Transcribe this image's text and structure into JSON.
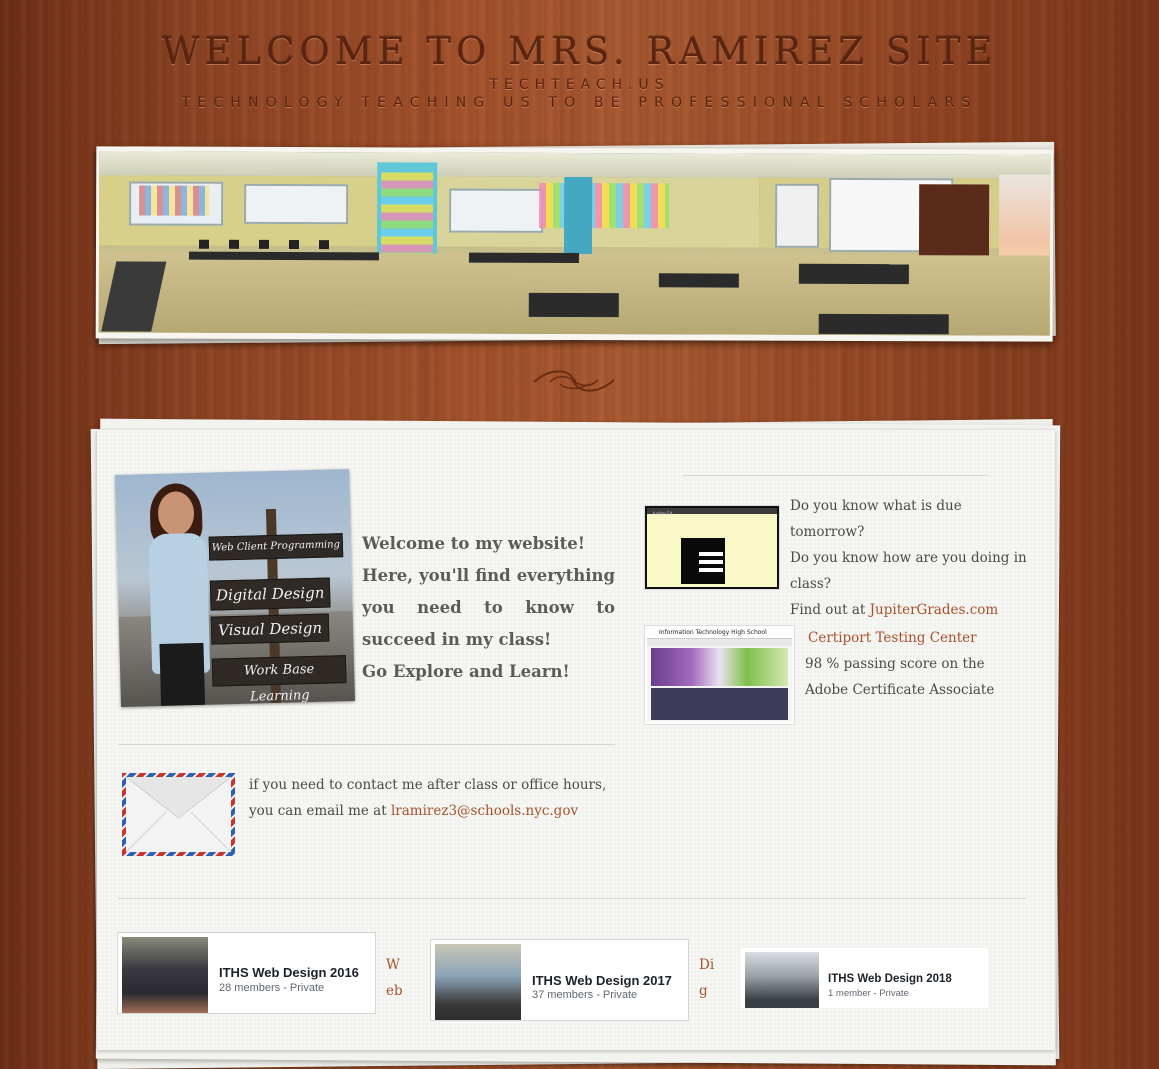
{
  "header": {
    "title": "WELCOME TO MRS. RAMIREZ SITE",
    "subtitle_domain": "TECHTEACH.US",
    "tagline": "TECHNOLOGY TEACHING US TO BE PROFESSIONAL SCHOLARS"
  },
  "banner": {
    "image": "classroom panorama photo"
  },
  "profile": {
    "image": "teacher photo with signpost",
    "signs": [
      "Web Client Programming",
      "Digital Design",
      "Visual Design",
      "Work Base Learning"
    ]
  },
  "welcome": {
    "line1": "Welcome to my website!",
    "line2": "Here, you'll find everything you need to know to succeed in my class!",
    "line3": "Go Explore and Learn!"
  },
  "jupiter": {
    "thumb_label": "Jupiter Ed",
    "line1": "Do you know what is due tomorrow?",
    "line2": "Do you know how are you doing in class?",
    "prefix": "Find out at ",
    "link": "JupiterGrades.com"
  },
  "certiport": {
    "thumb_label": "Information Technology High School",
    "link": "Certiport Testing Center",
    "line1": "98 % passing score  on the",
    "line2": "Adobe Certificate Associate"
  },
  "contact": {
    "text": " if you need to contact me after class or office hours, you can email me at ",
    "email": "lramirez3@schools.nyc.gov"
  },
  "groups": [
    {
      "title": "ITHS Web Design 2016",
      "meta": "28 members - Private",
      "side_link": "Web"
    },
    {
      "title": "ITHS Web Design 2017",
      "meta": "37 members - Private",
      "side_link": "Dig"
    },
    {
      "title": "ITHS Web Design 2018",
      "meta": "1 member - Private"
    }
  ],
  "colors": {
    "wood": "#9a4b27",
    "title_text": "#5a2410",
    "link": "#a8512a",
    "paper": "#f5f5f2"
  }
}
